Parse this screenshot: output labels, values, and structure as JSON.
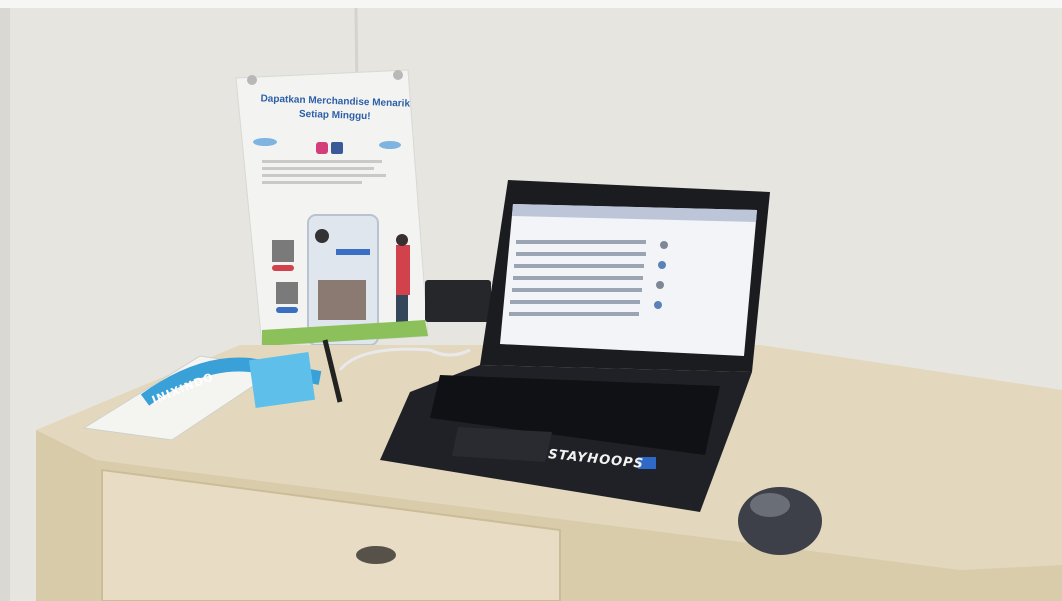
{
  "poster": {
    "title_line1": "Dapatkan Merchandise Menarik",
    "title_line2": "Setiap Minggu!"
  },
  "laptop": {
    "sticker_text": "STAYHOOPS"
  },
  "lanyard": {
    "text": "INIXINDO"
  },
  "colors": {
    "wall": "#e6e5e0",
    "desk_top": "#e3d8bd",
    "laptop_body": "#1b1c20",
    "screen": "#f3f4f7",
    "lanyard": "#3aa0d8",
    "mouse": "#3d4048"
  }
}
